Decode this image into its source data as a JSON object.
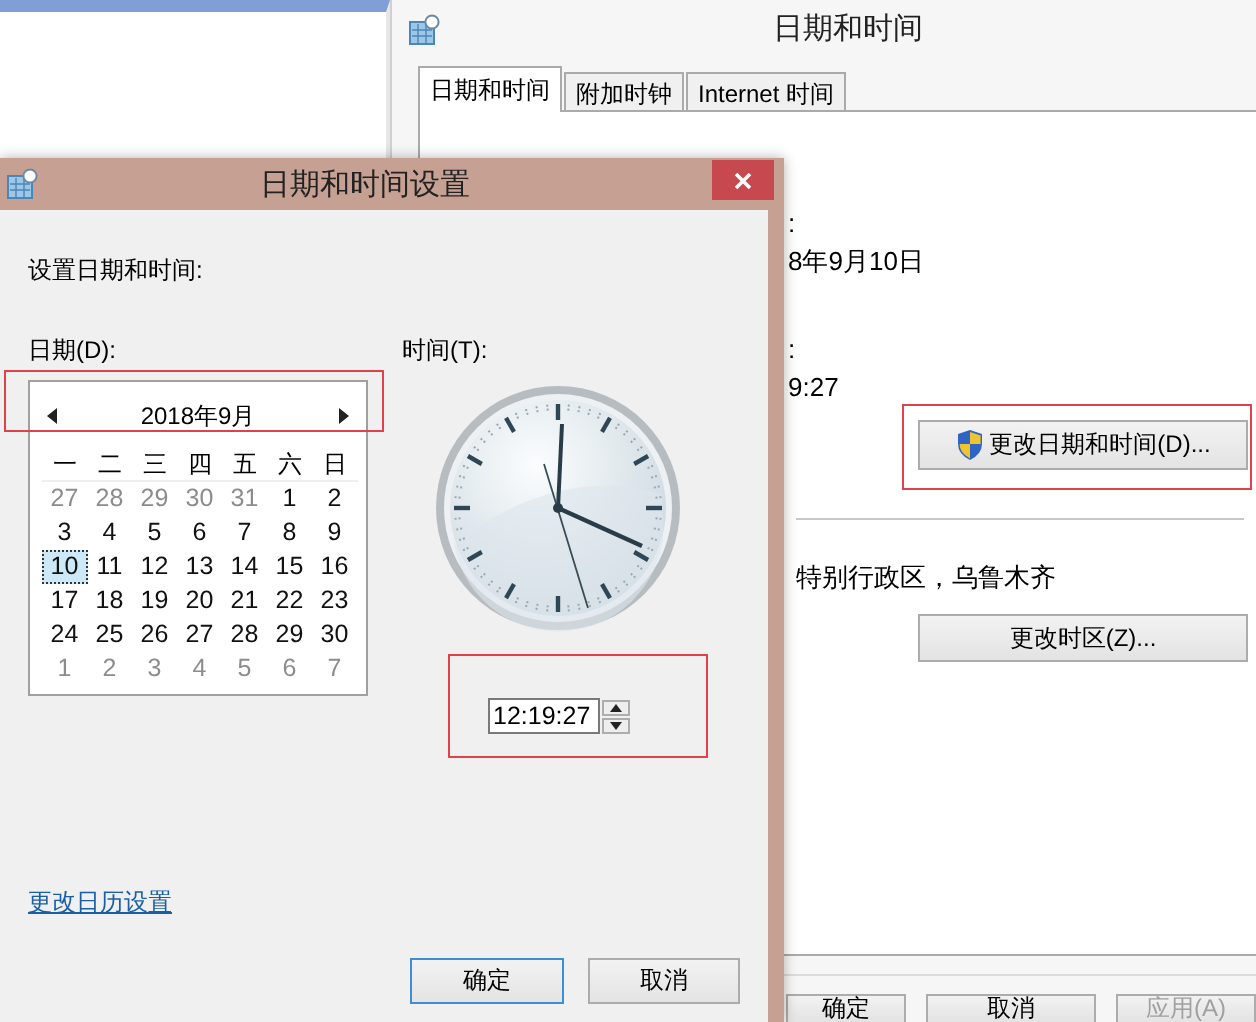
{
  "main_window": {
    "title": "日期和时间",
    "tabs": [
      {
        "label": "日期和时间",
        "selected": true
      },
      {
        "label": "附加时钟",
        "selected": false
      },
      {
        "label": "Internet 时间",
        "selected": false
      }
    ],
    "date_label": ":",
    "date_value": "8年9月10日",
    "time_label": ":",
    "time_value": "9:27",
    "change_datetime_button": "更改日期和时间(D)...",
    "time_zone": "特别行政区，乌鲁木齐",
    "change_time_zone_button": "更改时区(Z)...",
    "buttons": [
      {
        "label": "确定",
        "disabled": false
      },
      {
        "label": "取消",
        "disabled": false
      },
      {
        "label": "应用(A)",
        "disabled": true
      }
    ]
  },
  "dialog": {
    "title": "日期和时间设置",
    "heading": "设置日期和时间:",
    "date_label": "日期(D):",
    "calendar": {
      "month": "2018年9月",
      "weekdays": [
        "一",
        "二",
        "三",
        "四",
        "五",
        "六",
        "日"
      ],
      "weeks": [
        [
          {
            "day": "27",
            "other_month": true,
            "selected": false
          },
          {
            "day": "28",
            "other_month": true,
            "selected": false
          },
          {
            "day": "29",
            "other_month": true,
            "selected": false
          },
          {
            "day": "30",
            "other_month": true,
            "selected": false
          },
          {
            "day": "31",
            "other_month": true,
            "selected": false
          },
          {
            "day": "1",
            "other_month": false,
            "selected": false
          },
          {
            "day": "2",
            "other_month": false,
            "selected": false
          }
        ],
        [
          {
            "day": "3",
            "other_month": false,
            "selected": false
          },
          {
            "day": "4",
            "other_month": false,
            "selected": false
          },
          {
            "day": "5",
            "other_month": false,
            "selected": false
          },
          {
            "day": "6",
            "other_month": false,
            "selected": false
          },
          {
            "day": "7",
            "other_month": false,
            "selected": false
          },
          {
            "day": "8",
            "other_month": false,
            "selected": false
          },
          {
            "day": "9",
            "other_month": false,
            "selected": false
          }
        ],
        [
          {
            "day": "10",
            "other_month": false,
            "selected": true
          },
          {
            "day": "11",
            "other_month": false,
            "selected": false
          },
          {
            "day": "12",
            "other_month": false,
            "selected": false
          },
          {
            "day": "13",
            "other_month": false,
            "selected": false
          },
          {
            "day": "14",
            "other_month": false,
            "selected": false
          },
          {
            "day": "15",
            "other_month": false,
            "selected": false
          },
          {
            "day": "16",
            "other_month": false,
            "selected": false
          }
        ],
        [
          {
            "day": "17",
            "other_month": false,
            "selected": false
          },
          {
            "day": "18",
            "other_month": false,
            "selected": false
          },
          {
            "day": "19",
            "other_month": false,
            "selected": false
          },
          {
            "day": "20",
            "other_month": false,
            "selected": false
          },
          {
            "day": "21",
            "other_month": false,
            "selected": false
          },
          {
            "day": "22",
            "other_month": false,
            "selected": false
          },
          {
            "day": "23",
            "other_month": false,
            "selected": false
          }
        ],
        [
          {
            "day": "24",
            "other_month": false,
            "selected": false
          },
          {
            "day": "25",
            "other_month": false,
            "selected": false
          },
          {
            "day": "26",
            "other_month": false,
            "selected": false
          },
          {
            "day": "27",
            "other_month": false,
            "selected": false
          },
          {
            "day": "28",
            "other_month": false,
            "selected": false
          },
          {
            "day": "29",
            "other_month": false,
            "selected": false
          },
          {
            "day": "30",
            "other_month": false,
            "selected": false
          }
        ],
        [
          {
            "day": "1",
            "other_month": true,
            "selected": false
          },
          {
            "day": "2",
            "other_month": true,
            "selected": false
          },
          {
            "day": "3",
            "other_month": true,
            "selected": false
          },
          {
            "day": "4",
            "other_month": true,
            "selected": false
          },
          {
            "day": "5",
            "other_month": true,
            "selected": false
          },
          {
            "day": "6",
            "other_month": true,
            "selected": false
          },
          {
            "day": "7",
            "other_month": true,
            "selected": false
          }
        ]
      ]
    },
    "time_label": "时间(T):",
    "time_value": "12:19:27",
    "calendar_settings_link": "更改日历设置",
    "buttons": [
      {
        "label": "确定",
        "default": true
      },
      {
        "label": "取消",
        "default": false
      }
    ]
  }
}
